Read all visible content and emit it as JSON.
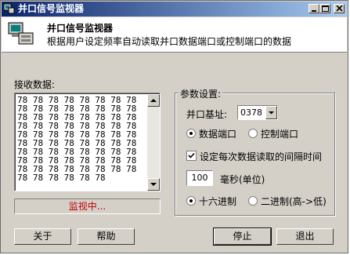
{
  "window": {
    "title": "并口信号监视器"
  },
  "header": {
    "title": "并口信号监视器",
    "description": "根据用户设定频率自动读取并口数据端口或控制端口的数据"
  },
  "receive": {
    "label": "接收数据:",
    "data": "78 78 78 78 78 78 78 78 78 78 78 78 78 78 78 78 78 78 78 78 78 78 78 78 78 78 78 78 78 78 78 78 78 78 78 78 78 78 78 78 78 78 78 78 78 78 78 78 78 78 78 78 78 78 78 78 78 78 78 78 78 78 78 78 78 78 78 78 78 78 78 78 78 78 78 78 78 78"
  },
  "status": "监视中...",
  "params": {
    "group_label": "参数设置:",
    "port_base_label": "并口基址:",
    "port_base_value": "0378",
    "data_port_label": "数据端口",
    "control_port_label": "控制端口",
    "selected_port": "data",
    "interval_check_label": "设定每次数据读取的间隔时间",
    "interval_checked": true,
    "interval_value": "100",
    "interval_unit_label": "毫秒(单位)",
    "hex_label": "十六进制",
    "binary_label": "二进制(高->低)",
    "selected_format": "hex"
  },
  "buttons": {
    "about": "关于",
    "help": "帮助",
    "stop": "停止",
    "exit": "退出"
  }
}
